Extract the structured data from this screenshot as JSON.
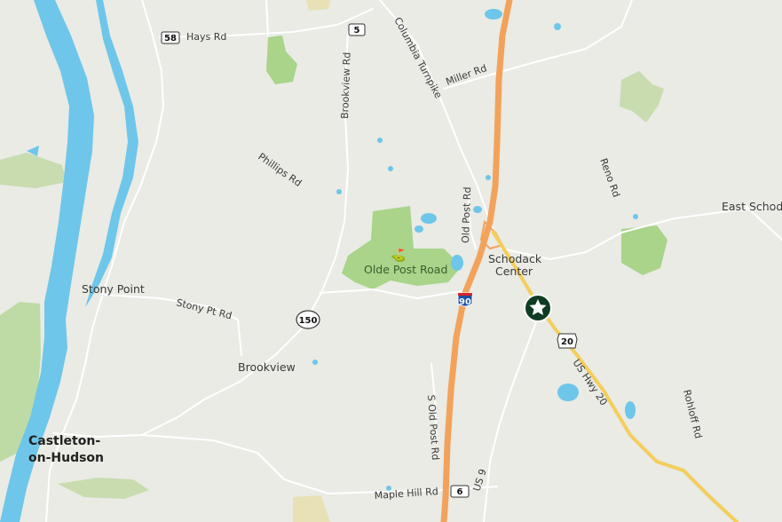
{
  "colors": {
    "land": "#e9ebe4",
    "water": "#6ec6ea",
    "park": "#a9d48a",
    "road": "#ffffff",
    "interstate": "#f3a25b",
    "us_highway": "#f4cd5c",
    "marker": "#0f3d24"
  },
  "labels": {
    "hays_rd": "Hays Rd",
    "brookview_rd": "Brookview Rd",
    "columbia_turnpike": "Columbia Turnpike",
    "miller_rd": "Miller Rd",
    "phillips_rd": "Phillips Rd",
    "reno_rd": "Reno Rd",
    "east_schodack": "East Schoda",
    "old_post_rd": "Old Post Rd",
    "olde_post_road": "Olde Post Road",
    "schodack_center": [
      "Schodack",
      "Center"
    ],
    "stony_point": "Stony Point",
    "stony_pt_rd": "Stony Pt Rd",
    "brookview": "Brookview",
    "castleton": [
      "Castleton-",
      "on-Hudson"
    ],
    "s_old_post_rd": "S Old Post Rd",
    "us_hwy_20": "US Hwy 20",
    "rohloff_rd": "Rohloff Rd",
    "us_9": "US 9",
    "maple_hill_rd": "Maple Hill Rd"
  },
  "shields": {
    "route_58": "58",
    "route_5": "5",
    "route_150": "150",
    "interstate_90": "90",
    "us_20": "20",
    "route_6": "6"
  },
  "marker": {
    "icon": "star-icon"
  },
  "poi": {
    "golf_icon": "golf-flag-icon"
  }
}
